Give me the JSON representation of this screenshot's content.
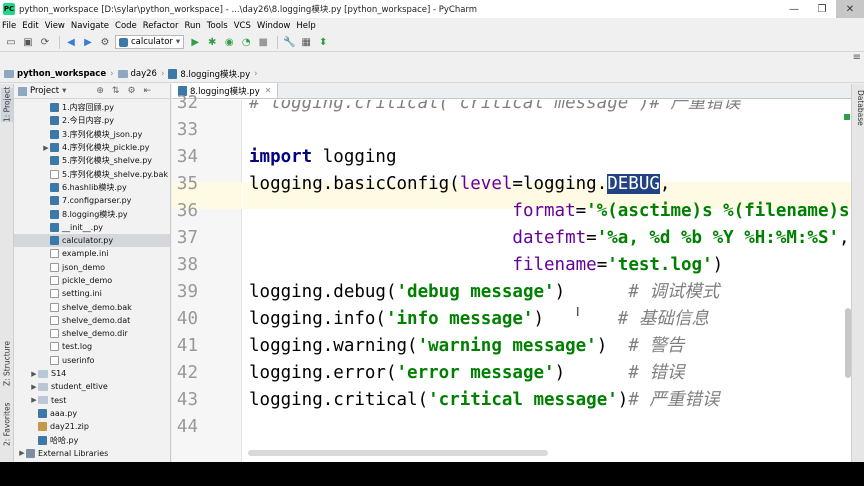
{
  "window": {
    "title": "python_workspace [D:\\sylar\\python_workspace] - ...\\day26\\8.logging模块.py [python_workspace] - PyCharm",
    "controls": {
      "minimize": "—",
      "maximize": "❐",
      "close": "✕"
    }
  },
  "menu": [
    "File",
    "Edit",
    "View",
    "Navigate",
    "Code",
    "Refactor",
    "Run",
    "Tools",
    "VCS",
    "Window",
    "Help"
  ],
  "toolbar": {
    "run_config": "calculator"
  },
  "breadcrumb": [
    "python_workspace",
    "day26",
    "8.logging模块.py"
  ],
  "side_tabs": {
    "left": [
      "1: Project",
      "Z: Structure",
      "2: Favorites"
    ],
    "right": [
      "Database"
    ]
  },
  "project_panel": {
    "title": "Project",
    "tree": [
      {
        "label": "1.内容回顾.py",
        "type": "py",
        "indent": 2,
        "arrow": ""
      },
      {
        "label": "2.今日内容.py",
        "type": "py",
        "indent": 2,
        "arrow": ""
      },
      {
        "label": "3.序列化模块_json.py",
        "type": "py",
        "indent": 2,
        "arrow": ""
      },
      {
        "label": "4.序列化模块_pickle.py",
        "type": "py",
        "indent": 2,
        "arrow": "▶"
      },
      {
        "label": "5.序列化模块_shelve.py",
        "type": "py",
        "indent": 2,
        "arrow": ""
      },
      {
        "label": "5.序列化模块_shelve.py.bak",
        "type": "file",
        "indent": 2,
        "arrow": ""
      },
      {
        "label": "6.hashlib模块.py",
        "type": "py",
        "indent": 2,
        "arrow": ""
      },
      {
        "label": "7.configparser.py",
        "type": "py",
        "indent": 2,
        "arrow": ""
      },
      {
        "label": "8.logging模块.py",
        "type": "py",
        "indent": 2,
        "arrow": ""
      },
      {
        "label": "__init__.py",
        "type": "py",
        "indent": 2,
        "arrow": ""
      },
      {
        "label": "calculator.py",
        "type": "py",
        "indent": 2,
        "arrow": "",
        "selected": true
      },
      {
        "label": "example.ini",
        "type": "file",
        "indent": 2,
        "arrow": ""
      },
      {
        "label": "json_demo",
        "type": "file",
        "indent": 2,
        "arrow": ""
      },
      {
        "label": "pickle_demo",
        "type": "file",
        "indent": 2,
        "arrow": ""
      },
      {
        "label": "setting.ini",
        "type": "file",
        "indent": 2,
        "arrow": ""
      },
      {
        "label": "shelve_demo.bak",
        "type": "file",
        "indent": 2,
        "arrow": ""
      },
      {
        "label": "shelve_demo.dat",
        "type": "file",
        "indent": 2,
        "arrow": ""
      },
      {
        "label": "shelve_demo.dir",
        "type": "file",
        "indent": 2,
        "arrow": ""
      },
      {
        "label": "test.log",
        "type": "file",
        "indent": 2,
        "arrow": ""
      },
      {
        "label": "userinfo",
        "type": "file",
        "indent": 2,
        "arrow": ""
      },
      {
        "label": "S14",
        "type": "folder",
        "indent": 1,
        "arrow": "▶"
      },
      {
        "label": "student_eltive",
        "type": "folder",
        "indent": 1,
        "arrow": "▶"
      },
      {
        "label": "test",
        "type": "folder",
        "indent": 1,
        "arrow": "▶"
      },
      {
        "label": "aaa.py",
        "type": "py",
        "indent": 1,
        "arrow": ""
      },
      {
        "label": "day21.zip",
        "type": "zip",
        "indent": 1,
        "arrow": ""
      },
      {
        "label": "哈哈.py",
        "type": "py",
        "indent": 1,
        "arrow": ""
      },
      {
        "label": "External Libraries",
        "type": "lib",
        "indent": 0,
        "arrow": "▶"
      }
    ]
  },
  "editor": {
    "tab_label": "8.logging模块.py",
    "line_numbers": [
      "32",
      "33",
      "34",
      "35",
      "36",
      "37",
      "38",
      "39",
      "40",
      "41",
      "42",
      "43",
      "44"
    ],
    "lines": {
      "l32": {
        "comment": "# logging.critical('critical message')# 严重错误"
      },
      "l34": {
        "kw": "import",
        "rest": " logging"
      },
      "l35": {
        "a": "logging.basicConfig(",
        "p": "level",
        "b": "=logging.",
        "sel": "DEBUG",
        "c": ","
      },
      "l36": {
        "indent": "                         ",
        "p": "format",
        "eq": "=",
        "s": "'%(asctime)s %(filename)s[line:%(l"
      },
      "l37": {
        "indent": "                         ",
        "p": "datefmt",
        "eq": "=",
        "s": "'%a, %d %b %Y %H:%M:%S'",
        "end": ","
      },
      "l38": {
        "indent": "                         ",
        "p": "filename",
        "eq": "=",
        "s": "'test.log'",
        "end": ")"
      },
      "l39": {
        "a": "logging.debug(",
        "s": "'debug message'",
        "b": ")      ",
        "c": "# 调试模式"
      },
      "l40": {
        "a": "logging.info(",
        "s": "'info message'",
        "b": ")       ",
        "c": "# 基础信息"
      },
      "l41": {
        "a": "logging.warning(",
        "s": "'warning message'",
        "b": ")  ",
        "c": "# 警告"
      },
      "l42": {
        "a": "logging.error(",
        "s": "'error message'",
        "b": ")      ",
        "c": "# 错误"
      },
      "l43": {
        "a": "logging.critical(",
        "s": "'critical message'",
        "b": ")",
        "c": "# 严重错误"
      }
    }
  }
}
